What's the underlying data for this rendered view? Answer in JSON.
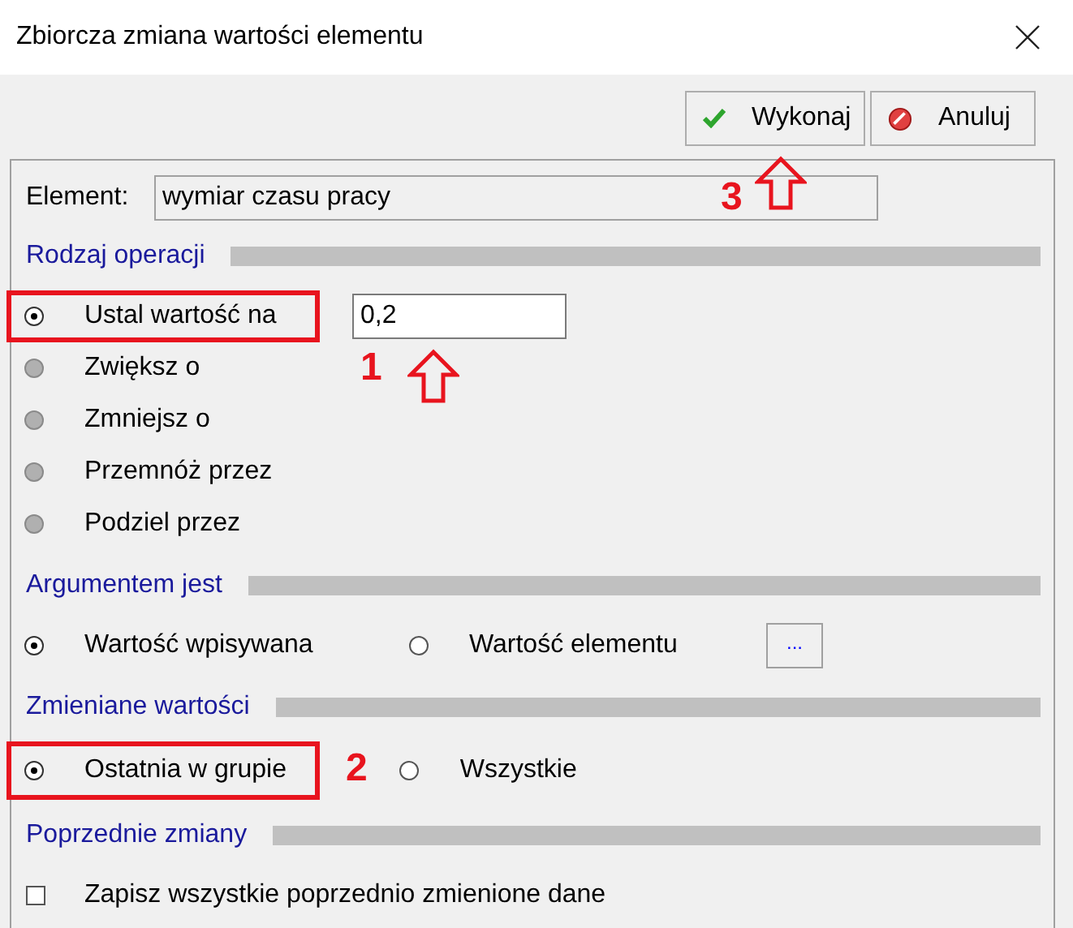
{
  "window": {
    "title": "Zbiorcza zmiana wartości elementu"
  },
  "buttons": [
    {
      "kind": "ok",
      "label": "Wykonaj",
      "callout": "3"
    },
    {
      "kind": "cancel",
      "label": "Anuluj"
    }
  ],
  "element": {
    "label": "Element:",
    "value": "wymiar czasu pracy"
  },
  "sections": [
    {
      "title": "Rodzaj operacji",
      "kind": "vertical",
      "options": [
        {
          "label": "Ustal wartość na",
          "selected": true,
          "disabled": false,
          "highlighted": true,
          "value": "0,2",
          "callout": "1"
        },
        {
          "label": "Zwiększ o",
          "selected": false,
          "disabled": true,
          "highlighted": false
        },
        {
          "label": "Zmniejsz o",
          "selected": false,
          "disabled": true,
          "highlighted": false
        },
        {
          "label": "Przemnóż przez",
          "selected": false,
          "disabled": true,
          "highlighted": false
        },
        {
          "label": "Podziel przez",
          "selected": false,
          "disabled": true,
          "highlighted": false
        }
      ]
    },
    {
      "title": "Argumentem jest",
      "kind": "horizontal",
      "options": [
        {
          "label": "Wartość wpisywana",
          "selected": true,
          "disabled": false,
          "highlighted": false
        },
        {
          "label": "Wartość elementu",
          "selected": false,
          "disabled": false,
          "highlighted": false
        }
      ],
      "browse_button": "..."
    },
    {
      "title": "Zmieniane wartości",
      "kind": "horizontal",
      "options": [
        {
          "label": "Ostatnia w grupie",
          "selected": true,
          "disabled": false,
          "highlighted": true,
          "callout": "2"
        },
        {
          "label": "Wszystkie",
          "selected": false,
          "disabled": false,
          "highlighted": false
        }
      ]
    },
    {
      "title": "Poprzednie zmiany",
      "kind": "checkbox",
      "checks": [
        {
          "label": "Zapisz wszystkie poprzednio zmienione dane",
          "checked": false
        }
      ]
    }
  ]
}
